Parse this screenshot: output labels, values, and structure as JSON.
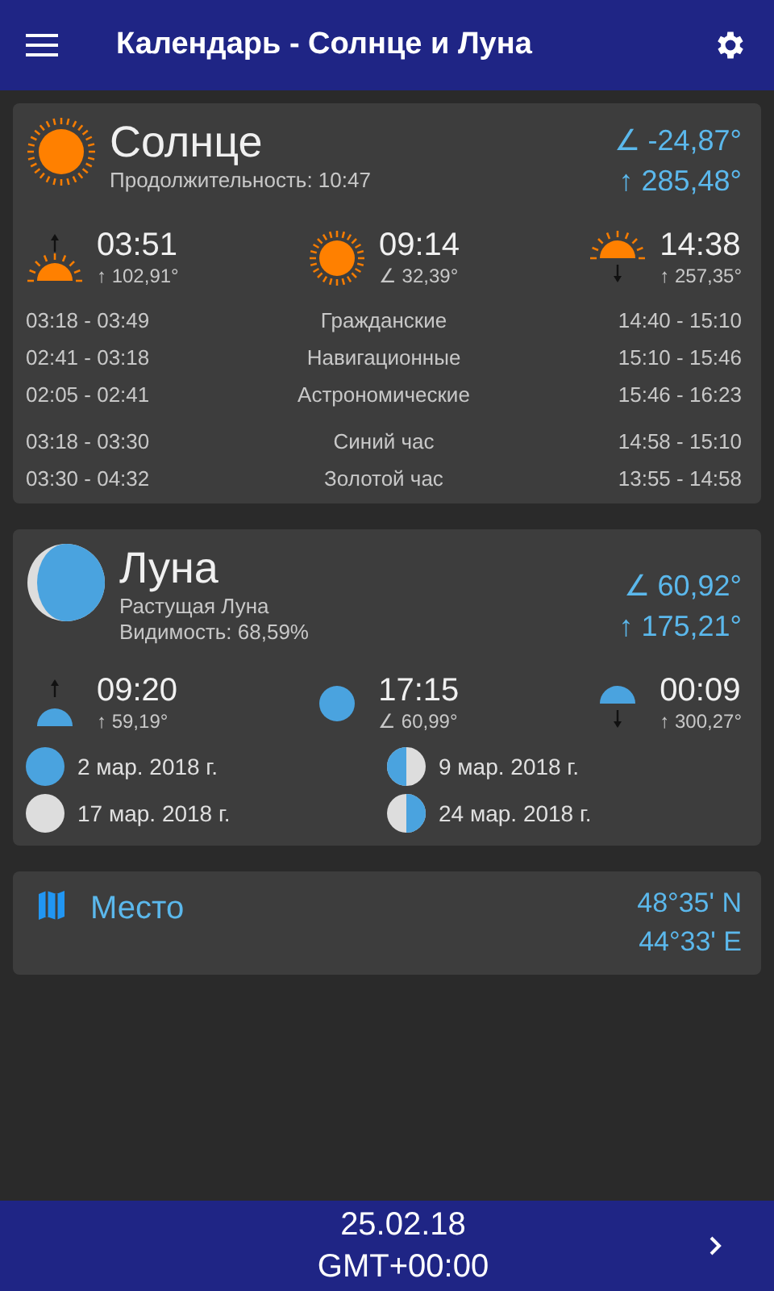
{
  "app_bar": {
    "title": "Календарь - Солнце и Луна"
  },
  "sun": {
    "title": "Солнце",
    "subtitles": [
      "Продолжительность: 10:47"
    ],
    "elevation": "∠ -24,87°",
    "azimuth": "↑ 285,48°",
    "events": [
      {
        "kind": "rise",
        "time": "03:51",
        "angle": "↑ 102,91°"
      },
      {
        "kind": "transit",
        "time": "09:14",
        "angle": "∠ 32,39°"
      },
      {
        "kind": "set",
        "time": "14:38",
        "angle": "↑ 257,35°"
      }
    ],
    "twilight": [
      {
        "morning": "03:18 - 03:49",
        "name": "Гражданские",
        "evening": "14:40 - 15:10"
      },
      {
        "morning": "02:41 - 03:18",
        "name": "Навигационные",
        "evening": "15:10 - 15:46"
      },
      {
        "morning": "02:05 - 02:41",
        "name": "Астрономические",
        "evening": "15:46 - 16:23"
      },
      {
        "morning": "03:18 - 03:30",
        "name": "Синий час",
        "evening": "14:58 - 15:10"
      },
      {
        "morning": "03:30 - 04:32",
        "name": "Золотой час",
        "evening": "13:55 - 14:58"
      }
    ]
  },
  "moon": {
    "title": "Луна",
    "subtitles": [
      "Растущая Луна",
      "Видимость: 68,59%"
    ],
    "elevation": "∠ 60,92°",
    "azimuth": "↑ 175,21°",
    "events": [
      {
        "kind": "rise",
        "time": "09:20",
        "angle": "↑ 59,19°"
      },
      {
        "kind": "transit",
        "time": "17:15",
        "angle": "∠ 60,99°"
      },
      {
        "kind": "set",
        "time": "00:09",
        "angle": "↑ 300,27°"
      }
    ],
    "phases": [
      {
        "kind": "full",
        "date": "2 мар. 2018 г."
      },
      {
        "kind": "last_quarter",
        "date": "9 мар. 2018 г."
      },
      {
        "kind": "new",
        "date": "17 мар. 2018 г."
      },
      {
        "kind": "first_quarter",
        "date": "24 мар. 2018 г."
      }
    ]
  },
  "place": {
    "title": "Место",
    "latitude": "48°35' N",
    "longitude": "44°33' E"
  },
  "bottom_bar": {
    "date": "25.02.18",
    "timezone": "GMT+00:00"
  }
}
